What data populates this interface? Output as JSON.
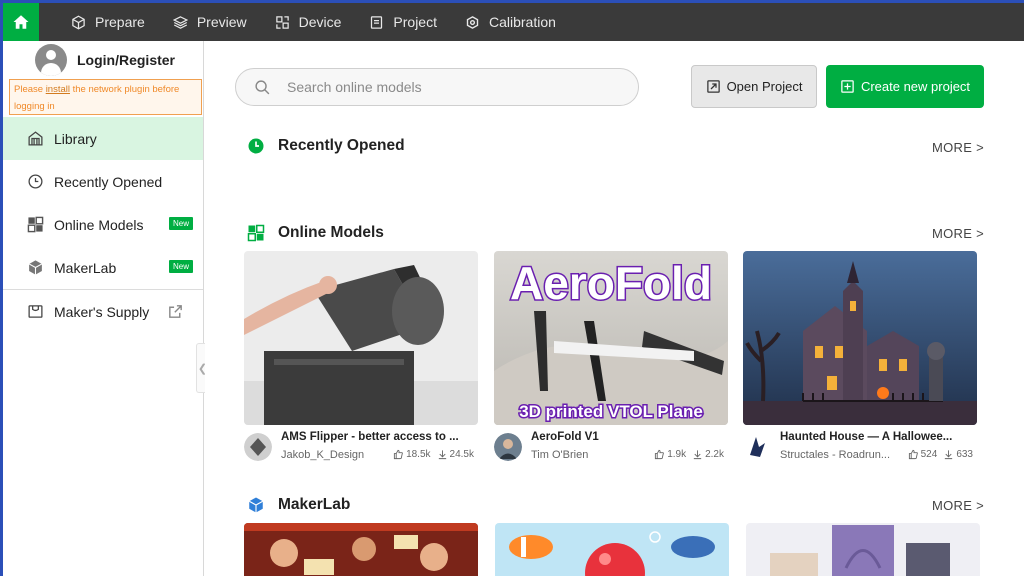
{
  "nav": {
    "tabs": [
      {
        "label": "Prepare",
        "icon": "cube-icon"
      },
      {
        "label": "Preview",
        "icon": "layers-icon"
      },
      {
        "label": "Device",
        "icon": "device-icon"
      },
      {
        "label": "Project",
        "icon": "project-icon"
      },
      {
        "label": "Calibration",
        "icon": "calibration-icon"
      }
    ]
  },
  "sidebar": {
    "login_label": "Login/Register",
    "notice_before": "Please ",
    "notice_link": "install",
    "notice_after": " the network plugin before logging in",
    "items": [
      {
        "label": "Library",
        "icon": "library-icon",
        "active": true
      },
      {
        "label": "Recently Opened",
        "icon": "clock-icon"
      },
      {
        "label": "Online Models",
        "icon": "grid-icon",
        "badge": "New"
      },
      {
        "label": "MakerLab",
        "icon": "makerlab-icon",
        "badge": "New"
      },
      {
        "label": "Maker's Supply",
        "icon": "supply-icon"
      }
    ]
  },
  "main": {
    "search_placeholder": "Search online models",
    "open_project": "Open Project",
    "create_project": "Create new project",
    "sections": {
      "recent": {
        "title": "Recently Opened",
        "more": "MORE >"
      },
      "online": {
        "title": "Online Models",
        "more": "MORE >"
      },
      "makerlab": {
        "title": "MakerLab",
        "more": "MORE >"
      }
    },
    "cards": [
      {
        "title": "AMS Flipper - better access to ...",
        "author": "Jakob_K_Design",
        "likes": "18.5k",
        "downloads": "24.5k"
      },
      {
        "title": "AeroFold V1",
        "author": "Tim O'Brien",
        "likes": "1.9k",
        "downloads": "2.2k",
        "thumb_title": "AeroFold",
        "thumb_subtitle": "3D printed VTOL Plane"
      },
      {
        "title": "Haunted House — A Hallowee...",
        "author": "Structales - Roadrun...",
        "likes": "524",
        "downloads": "633"
      }
    ]
  },
  "colors": {
    "accent": "#00ae42",
    "topbar": "#3a3a3a",
    "active_item": "#d9f5e1"
  }
}
